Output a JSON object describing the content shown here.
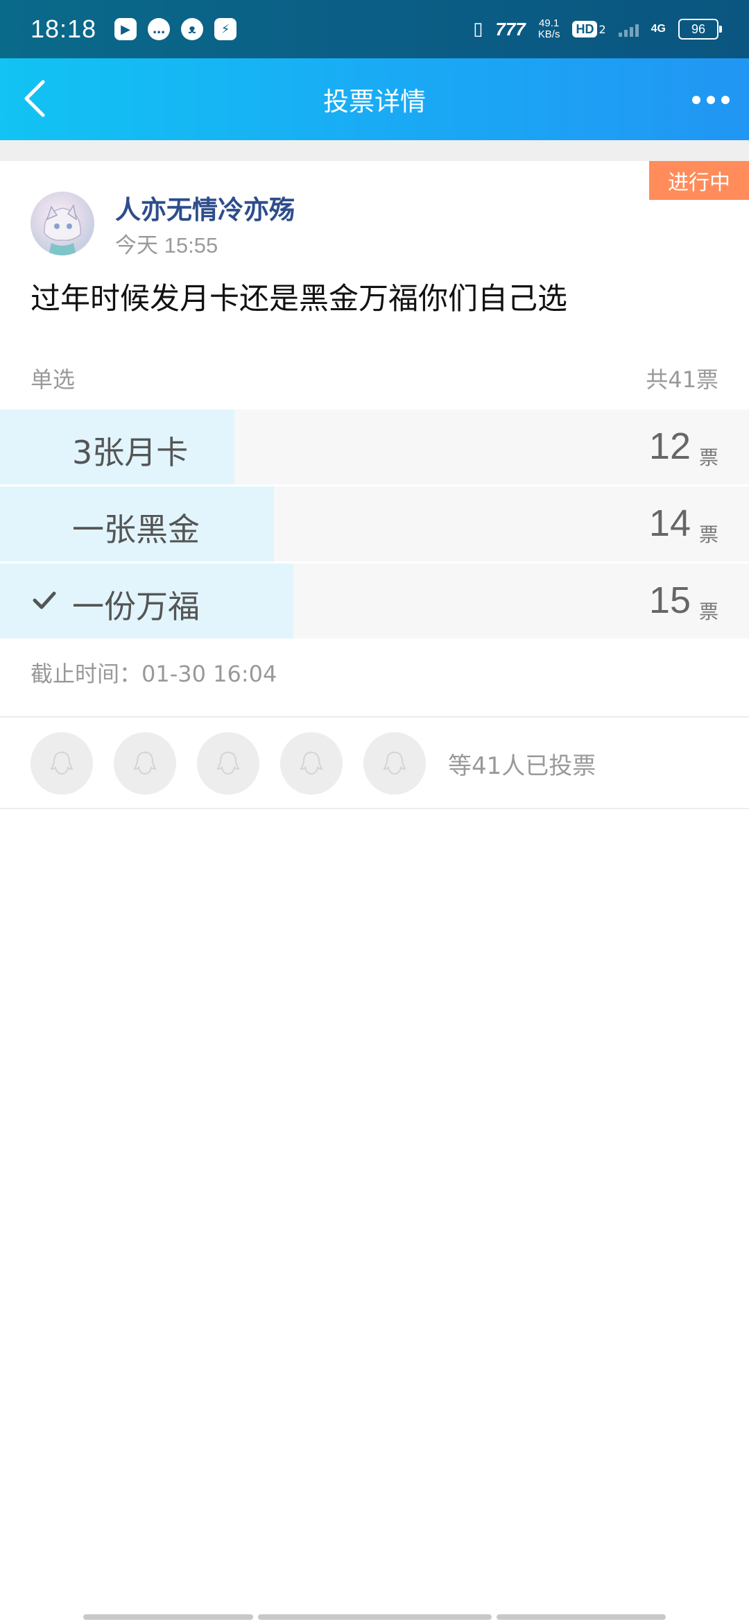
{
  "status_bar": {
    "time": "18:18",
    "net_speed_value": "49.1",
    "net_speed_unit": "KB/s",
    "hd_label": "HD",
    "hd_sub": "2",
    "network_label": "4G",
    "battery_level": "96",
    "icons": [
      "video-app-icon",
      "chat-app-icon",
      "cat-app-icon",
      "flash-app-icon",
      "vibrate-icon",
      "speed-icon",
      "signal-icon"
    ]
  },
  "header": {
    "title": "投票详情",
    "back_icon": "chevron-left-icon",
    "more_icon": "more-dots-icon"
  },
  "post": {
    "status_tag": "进行中",
    "author": "人亦无情冷亦殇",
    "time": "今天 15:55",
    "question": "过年时候发月卡还是黑金万福你们自己选",
    "vote_type": "单选",
    "total_votes": "共41票"
  },
  "options": [
    {
      "label": "3张月卡",
      "count": "12",
      "unit": "票",
      "votes": 12,
      "selected": false
    },
    {
      "label": "一张黑金",
      "count": "14",
      "unit": "票",
      "votes": 14,
      "selected": false
    },
    {
      "label": "一份万福",
      "count": "15",
      "unit": "票",
      "votes": 15,
      "selected": true
    }
  ],
  "deadline": "截止时间：01-30 16:04",
  "voters": {
    "summary": "等41人已投票",
    "avatar_count": 5
  },
  "colors": {
    "title_bar_start": "#12c3f3",
    "title_bar_end": "#2196f3",
    "status_tag": "#ff8c5a",
    "author": "#2d4d8c",
    "option_fill": "#e2f5fd"
  }
}
